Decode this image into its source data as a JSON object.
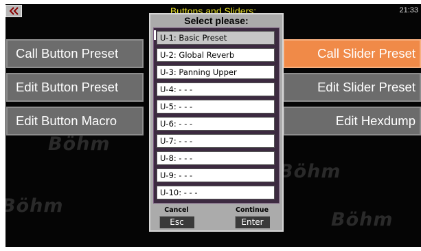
{
  "header": {
    "title": "Buttons and Sliders:",
    "clock": "21:33",
    "back_icon": "double-chevron-left-icon"
  },
  "watermark": {
    "logo_text": "Böhm"
  },
  "left_buttons": [
    {
      "label": "Call Button Preset"
    },
    {
      "label": "Edit Button Preset"
    },
    {
      "label": "Edit Button Macro"
    }
  ],
  "right_buttons": [
    {
      "label": "Call Slider Preset",
      "active": true
    },
    {
      "label": "Edit Slider Preset"
    },
    {
      "label": "Edit Hexdump"
    }
  ],
  "dialog": {
    "title": "Select please:",
    "items": [
      {
        "label": "U-1: Basic Preset",
        "selected": true
      },
      {
        "label": "U-2: Global Reverb"
      },
      {
        "label": "U-3: Panning Upper"
      },
      {
        "label": "U-4: - - -"
      },
      {
        "label": "U-5: - - -"
      },
      {
        "label": "U-6: - - -"
      },
      {
        "label": "U-7: - - -"
      },
      {
        "label": "U-8: - - -"
      },
      {
        "label": "U-9: - - -"
      },
      {
        "label": "U-10: - - -"
      }
    ],
    "cancel": {
      "caption": "Cancel",
      "button": "Esc"
    },
    "continue": {
      "caption": "Continue",
      "button": "Enter"
    }
  },
  "colors": {
    "title": "#e8e02a",
    "button": "#6c6c6c",
    "active_button": "#f08a48"
  }
}
